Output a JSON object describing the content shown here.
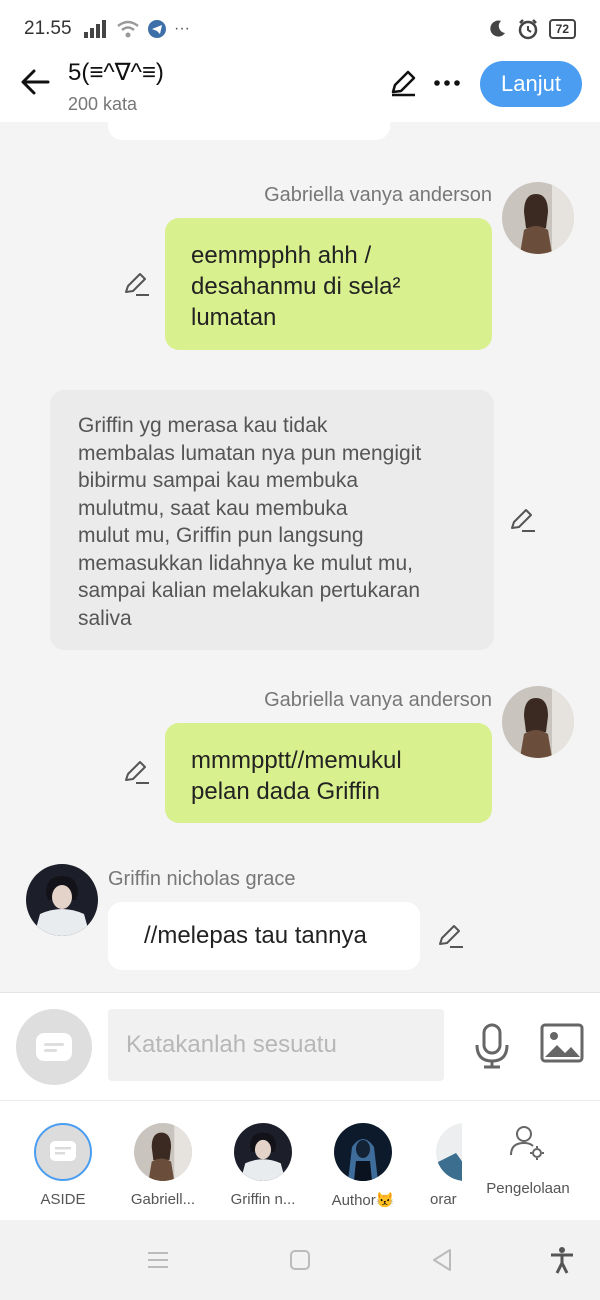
{
  "status": {
    "time": "21.55",
    "battery": "72"
  },
  "header": {
    "title": "5(≡^∇^≡)",
    "word_count": "200 kata",
    "next_label": "Lanjut"
  },
  "messages": [
    {
      "sender": "Gabriella vanya anderson",
      "lines": [
        "eemmpphh ahh /",
        "desahanmu di sela²",
        "lumatan"
      ]
    },
    {
      "lines": [
        "Griffin yg merasa kau tidak",
        "membalas lumatan nya pun mengigit",
        "bibirmu sampai kau membuka",
        "mulutmu, saat kau membuka",
        "mulut mu, Griffin pun langsung",
        "memasukkan lidahnya ke mulut mu,",
        "sampai kalian melakukan pertukaran",
        "saliva"
      ]
    },
    {
      "sender": "Gabriella vanya anderson",
      "lines": [
        "mmmpptt//memukul",
        "pelan dada Griffin"
      ]
    },
    {
      "sender": "Griffin nicholas grace",
      "text": "//melepas tau tannya"
    }
  ],
  "input": {
    "placeholder": "Katakanlah sesuatu"
  },
  "characters": [
    {
      "name": "ASIDE"
    },
    {
      "name": "Gabriell..."
    },
    {
      "name": "Griffin n..."
    },
    {
      "name": "Author😾"
    },
    {
      "name": "orar"
    }
  ],
  "manage_label": "Pengelolaan",
  "colors": {
    "accent": "#4a9df0",
    "user_bubble": "#d9f08e",
    "narration_bubble": "#ebebeb"
  }
}
